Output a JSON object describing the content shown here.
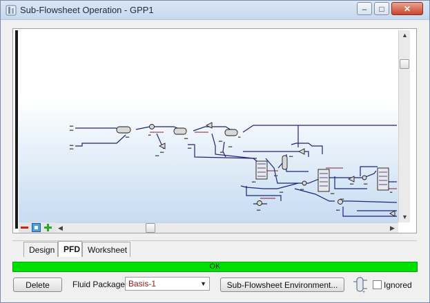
{
  "window": {
    "title": "Sub-Flowsheet Operation - GPP1"
  },
  "tabs": [
    {
      "label": "Design"
    },
    {
      "label": "PFD"
    },
    {
      "label": "Worksheet"
    }
  ],
  "status": {
    "text": "OK",
    "color": "#00e000"
  },
  "footer": {
    "delete_label": "Delete",
    "fluid_package_label": "Fluid Package",
    "fluid_package_value": "Basis-1",
    "environment_label": "Sub-Flowsheet Environment...",
    "ignored_label": "Ignored",
    "ignored_checked": false
  },
  "pfd": {
    "stream_color": "#1a237e",
    "energy_color": "#8b1a2b",
    "zoom_tools": [
      {
        "icon": "zoom-out-icon"
      },
      {
        "icon": "zoom-fit-icon"
      },
      {
        "icon": "zoom-in-icon"
      }
    ]
  }
}
